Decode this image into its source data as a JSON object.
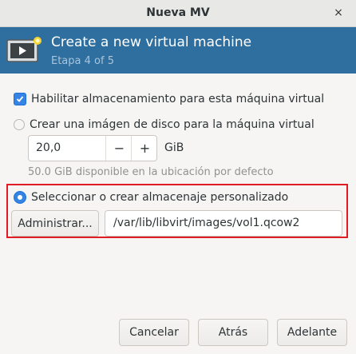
{
  "window": {
    "title": "Nueva MV",
    "close_glyph": "×"
  },
  "banner": {
    "icon": "virtual-machine-icon",
    "heading": "Create a new virtual machine",
    "step": "Etapa 4 of 5"
  },
  "storage": {
    "enable_label": "Habilitar almacenamiento para esta máquina virtual",
    "enable_checked": true,
    "create_image_label": "Crear una imágen de disco para la máquina virtual",
    "create_image_selected": false,
    "size_value": "20,0",
    "decrement": "−",
    "increment": "+",
    "size_unit": "GiB",
    "available_text": "50.0 GiB disponible en la ubicación por defecto",
    "custom_label": "Seleccionar o crear almacenaje personalizado",
    "custom_selected": true,
    "manage_button": "Administrar...",
    "path_value": "/var/lib/libvirt/images/vol1.qcow2"
  },
  "footer": {
    "cancel": "Cancelar",
    "back": "Atrás",
    "forward": "Adelante"
  },
  "colors": {
    "banner": "#2f6f9f",
    "accent": "#3584e4",
    "highlight_border": "#e01b24"
  }
}
